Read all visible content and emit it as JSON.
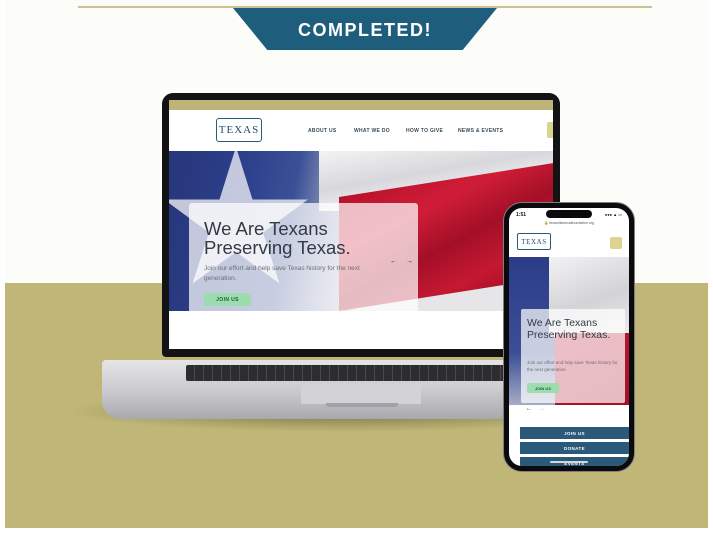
{
  "banner": {
    "label": "COMPLETED!"
  },
  "colors": {
    "banner": "#1f5d7c",
    "olive": "#bfb677",
    "accent_green": "#9ddcae",
    "nav_blue": "#2b5979"
  },
  "site": {
    "logo_text": "TEXAS",
    "nav": [
      "ABOUT US",
      "WHAT WE DO",
      "HOW TO GIVE",
      "NEWS & EVENTS"
    ],
    "hero_title": "We Are Texans Preserving Texas.",
    "hero_subtitle": "Join our effort and help save Texas history for the next generation.",
    "join_button": "JOIN US",
    "prev_arrow": "←",
    "next_arrow": "→"
  },
  "phone": {
    "time": "1:51",
    "status_icons": "●●● ▲ ▭",
    "url": "🔒 texashistoricalfoundation.org",
    "buttons": [
      "JOIN US",
      "DONATE",
      "EVENTS"
    ]
  },
  "icons": [
    "menu-icon",
    "arrow-left-icon",
    "arrow-right-icon"
  ]
}
